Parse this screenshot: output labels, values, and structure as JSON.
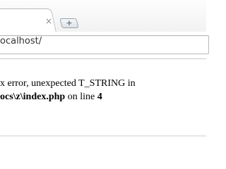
{
  "tab": {
    "close_glyph": "×"
  },
  "new_tab": {
    "icon": "plus-icon",
    "glyph": "+"
  },
  "address_bar": {
    "url": "ocalhost/"
  },
  "page": {
    "error_line1": "x error, unexpected T_STRING in",
    "error_path": "ocs\\z\\index.php",
    "error_mid": " on line ",
    "error_line_number": "4"
  }
}
